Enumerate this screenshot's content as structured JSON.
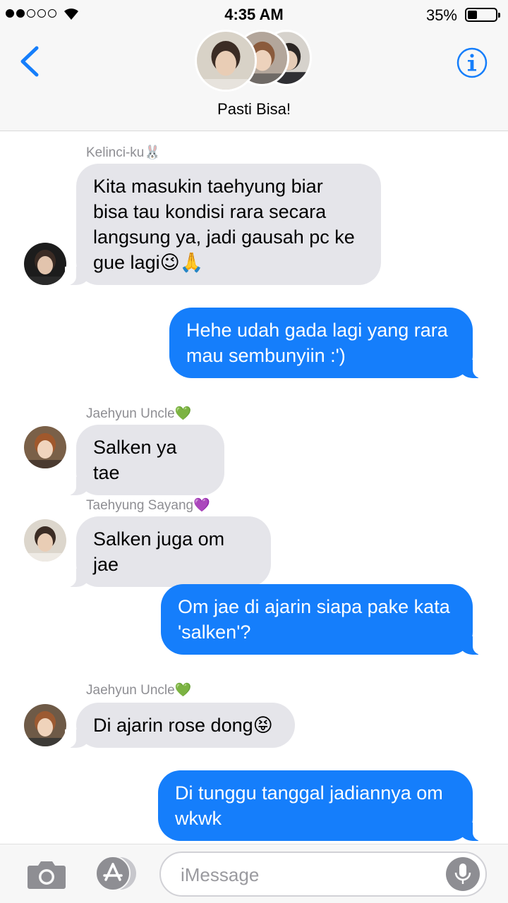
{
  "status": {
    "time": "4:35 AM",
    "battery_pct": "35%",
    "battery_level": 0.35,
    "signal_bars_filled": 2,
    "signal_bars_total": 5
  },
  "header": {
    "back_icon": "chevron-left-icon",
    "title": "Pasti Bisa!",
    "info_icon": "info-circle-icon",
    "accent_color": "#157efb"
  },
  "messages": [
    {
      "direction": "in",
      "sender": "Kelinci-ku🐰",
      "lines": [
        "Kita masukin taehyung biar",
        "bisa tau kondisi rara secara",
        "langsung ya, jadi gausah pc ke",
        "gue lagi😉🙏"
      ]
    },
    {
      "direction": "out",
      "lines": [
        "Hehe udah gada lagi yang rara",
        "mau sembunyiin :')"
      ]
    },
    {
      "direction": "in",
      "sender": "Jaehyun Uncle💚",
      "lines": [
        "Salken ya tae"
      ]
    },
    {
      "direction": "in",
      "sender": "Taehyung Sayang💜",
      "lines": [
        "Salken juga om jae"
      ]
    },
    {
      "direction": "out",
      "lines": [
        "Om jae di ajarin siapa pake kata",
        "'salken'?"
      ]
    },
    {
      "direction": "in",
      "sender": "Jaehyun Uncle💚",
      "lines": [
        "Di ajarin rose dong😝"
      ]
    },
    {
      "direction": "out",
      "lines": [
        "Di tunggu tanggal jadiannya om",
        "wkwk"
      ]
    }
  ],
  "input": {
    "placeholder": "iMessage",
    "camera_icon": "camera-icon",
    "apps_icon": "app-store-icon",
    "mic_icon": "microphone-icon"
  },
  "colors": {
    "incoming_bubble": "#e5e5ea",
    "outgoing_bubble": "#157efb",
    "sender_label": "#8e8e93"
  }
}
